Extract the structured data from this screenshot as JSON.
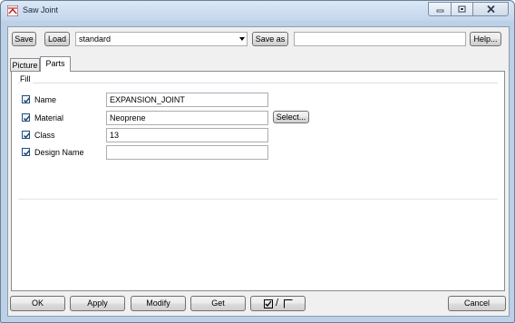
{
  "window": {
    "title": "Saw Joint",
    "colors": {
      "frame": "#bcd0e6",
      "client": "#f0f0f0",
      "close": "#c75050"
    }
  },
  "toolbar": {
    "save_label": "Save",
    "load_label": "Load",
    "preset_value": "standard",
    "save_as_label": "Save as",
    "save_as_value": "",
    "help_label": "Help..."
  },
  "tabs": [
    {
      "label": "Picture",
      "active": false
    },
    {
      "label": "Parts",
      "active": true
    }
  ],
  "fill_group": {
    "title": "Fill",
    "rows": [
      {
        "label": "Name",
        "checked": true,
        "value": "EXPANSION_JOINT"
      },
      {
        "label": "Material",
        "checked": true,
        "value": "Neoprene",
        "button": "Select..."
      },
      {
        "label": "Class",
        "checked": true,
        "value": "13"
      },
      {
        "label": "Design Name",
        "checked": true,
        "value": ""
      }
    ]
  },
  "footer": {
    "ok_label": "OK",
    "apply_label": "Apply",
    "modify_label": "Modify",
    "get_label": "Get",
    "toggle_label": "/",
    "cancel_label": "Cancel"
  }
}
